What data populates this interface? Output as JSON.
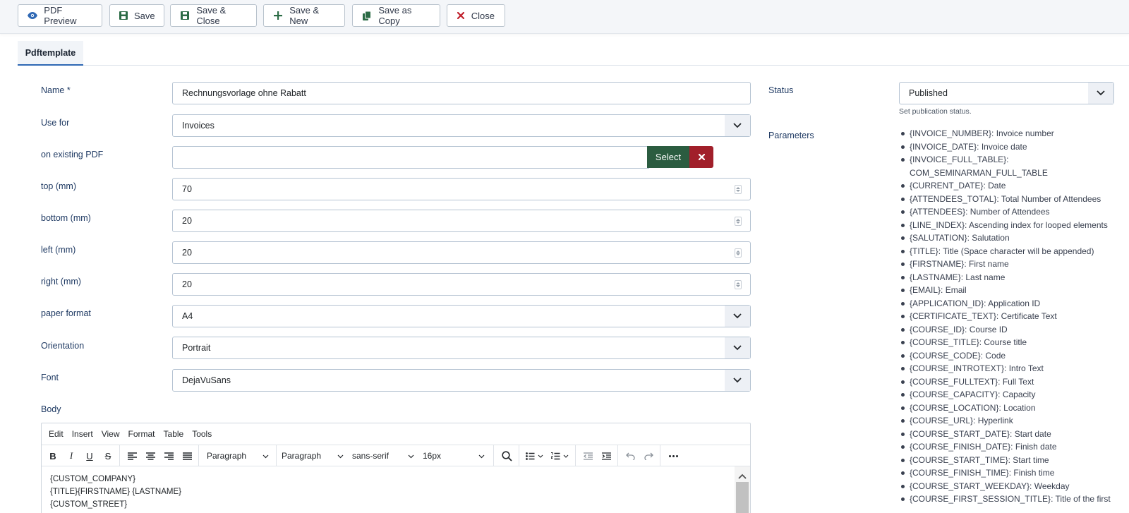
{
  "toolbar": {
    "pdf_preview": "PDF Preview",
    "save": "Save",
    "save_close": "Save & Close",
    "save_new": "Save & New",
    "save_copy": "Save as Copy",
    "close": "Close"
  },
  "tabs": [
    {
      "label": "Pdftemplate"
    }
  ],
  "form": {
    "name_label": "Name *",
    "name_value": "Rechnungsvorlage ohne Rabatt",
    "usefor_label": "Use for",
    "usefor_value": "Invoices",
    "existing_label": "on existing PDF",
    "existing_value": "",
    "select_label": "Select",
    "top_label": "top (mm)",
    "top_value": "70",
    "bottom_label": "bottom (mm)",
    "bottom_value": "20",
    "left_label": "left (mm)",
    "left_value": "20",
    "right_label": "right (mm)",
    "right_value": "20",
    "paper_label": "paper format",
    "paper_value": "A4",
    "orient_label": "Orientation",
    "orient_value": "Portrait",
    "font_label": "Font",
    "font_value": "DejaVuSans",
    "body_label": "Body"
  },
  "editor": {
    "menu": [
      "Edit",
      "Insert",
      "View",
      "Format",
      "Table",
      "Tools"
    ],
    "block1": "Paragraph",
    "block2": "Paragraph",
    "font_family": "sans-serif",
    "font_size": "16px",
    "content_lines": [
      "{CUSTOM_COMPANY}",
      "{TITLE}{FIRSTNAME} {LASTNAME}",
      "{CUSTOM_STREET}"
    ]
  },
  "right": {
    "status_label": "Status",
    "status_value": "Published",
    "status_help": "Set publication status.",
    "params_label": "Parameters",
    "params": [
      "{INVOICE_NUMBER}: Invoice number",
      "{INVOICE_DATE}: Invoice date",
      "{INVOICE_FULL_TABLE}: COM_SEMINARMAN_FULL_TABLE",
      "{CURRENT_DATE}: Date",
      "{ATTENDEES_TOTAL}: Total Number of Attendees",
      "{ATTENDEES}: Number of Attendees",
      "{LINE_INDEX}: Ascending index for looped elements",
      "{SALUTATION}: Salutation",
      "{TITLE}: Title (Space character will be appended)",
      "{FIRSTNAME}: First name",
      "{LASTNAME}: Last name",
      "{EMAIL}: Email",
      "{APPLICATION_ID}: Application ID",
      "{CERTIFICATE_TEXT}: Certificate Text",
      "{COURSE_ID}: Course ID",
      "{COURSE_TITLE}: Course title",
      "{COURSE_CODE}: Code",
      "{COURSE_INTROTEXT}: Intro Text",
      "{COURSE_FULLTEXT}: Full Text",
      "{COURSE_CAPACITY}: Capacity",
      "{COURSE_LOCATION}: Location",
      "{COURSE_URL}: Hyperlink",
      "{COURSE_START_DATE}: Start date",
      "{COURSE_FINISH_DATE}: Finish date",
      "{COURSE_START_TIME}: Start time",
      "{COURSE_FINISH_TIME}: Finish time",
      "{COURSE_START_WEEKDAY}: Weekday",
      "{COURSE_FIRST_SESSION_TITLE}: Title of the first"
    ]
  },
  "colors": {
    "accent": "#2f68b4",
    "save_green": "#2b6b45",
    "close_red": "#c0202c",
    "select_green": "#2b5c40",
    "clear_red": "#a11f2a",
    "label_blue": "#1f3a63"
  },
  "icons": {
    "pdf_preview": "eye-icon",
    "save": "floppy-icon",
    "save_close": "floppy-icon",
    "save_new": "plus-icon",
    "save_copy": "copy-icon",
    "close": "x-icon"
  }
}
